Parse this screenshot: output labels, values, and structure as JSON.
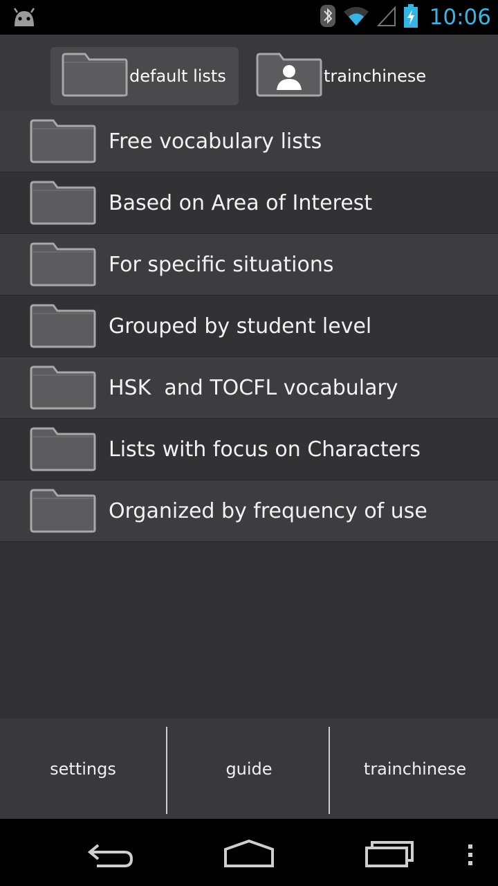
{
  "status_bar": {
    "time": "10:06",
    "icons": [
      "android-icon",
      "bluetooth-icon",
      "wifi-icon",
      "signal-icon",
      "battery-charging-icon"
    ]
  },
  "tabs": [
    {
      "label": "default lists",
      "icon": "folder-icon",
      "active": true
    },
    {
      "label": "trainchinese",
      "icon": "user-folder-icon",
      "active": false
    }
  ],
  "folders": [
    {
      "label": "Free vocabulary lists"
    },
    {
      "label": "Based on Area of Interest"
    },
    {
      "label": "For specific situations"
    },
    {
      "label": "Grouped by student level"
    },
    {
      "label": "HSK  and TOCFL vocabulary"
    },
    {
      "label": "Lists with focus on Characters"
    },
    {
      "label": "Organized by frequency of use"
    }
  ],
  "bottom_bar": {
    "settings": "settings",
    "guide": "guide",
    "trainchinese": "trainchinese"
  },
  "nav_bar": {
    "icons": [
      "back-icon",
      "home-icon",
      "recent-apps-icon",
      "overflow-menu-icon"
    ]
  },
  "colors": {
    "accent_clock": "#33b5e5",
    "background": "#313133"
  }
}
